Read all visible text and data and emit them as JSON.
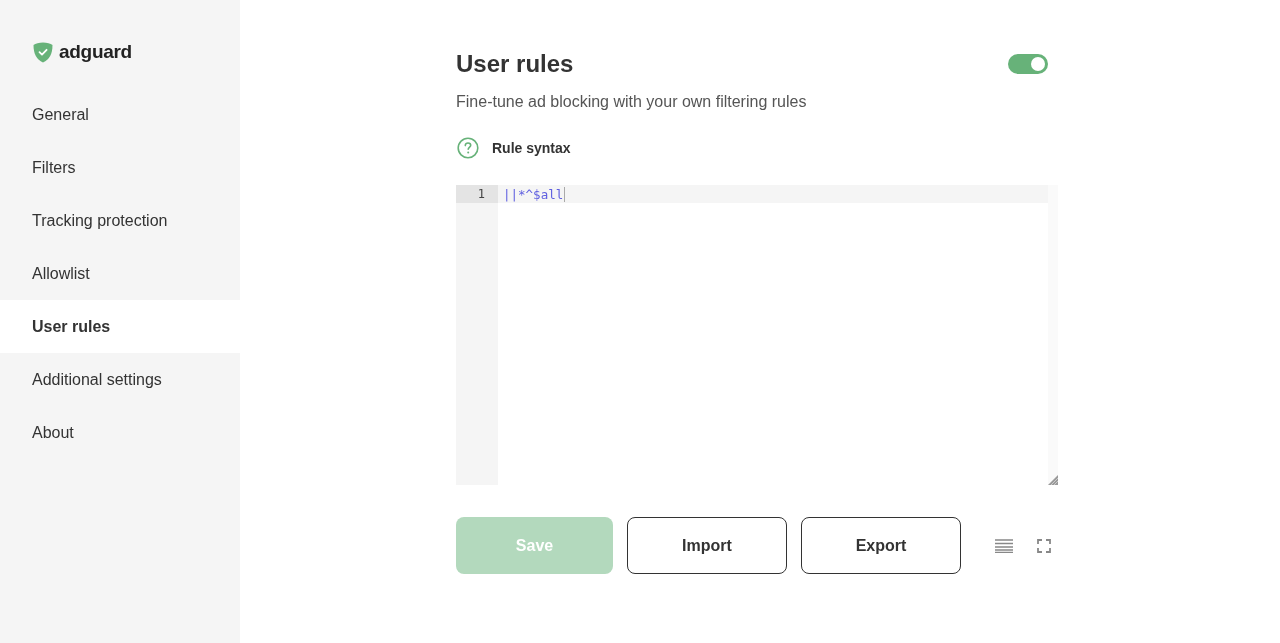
{
  "sidebar": {
    "logo": "adguard",
    "items": [
      {
        "label": "General",
        "selected": false
      },
      {
        "label": "Filters",
        "selected": false
      },
      {
        "label": "Tracking protection",
        "selected": false
      },
      {
        "label": "Allowlist",
        "selected": false
      },
      {
        "label": "User rules",
        "selected": true
      },
      {
        "label": "Additional settings",
        "selected": false
      },
      {
        "label": "About",
        "selected": false
      }
    ]
  },
  "header": {
    "title": "User rules",
    "enabled": true,
    "subtitle": "Fine-tune ad blocking with your own filtering rules",
    "help_link": "Rule syntax"
  },
  "editor": {
    "lines": [
      {
        "number": "1",
        "text": "||*^$all",
        "active": true
      }
    ]
  },
  "buttons": [
    {
      "label": "Save",
      "kind": "primary",
      "disabled": true
    },
    {
      "label": "Import",
      "kind": "outline",
      "disabled": false
    },
    {
      "label": "Export",
      "kind": "outline",
      "disabled": false
    }
  ]
}
